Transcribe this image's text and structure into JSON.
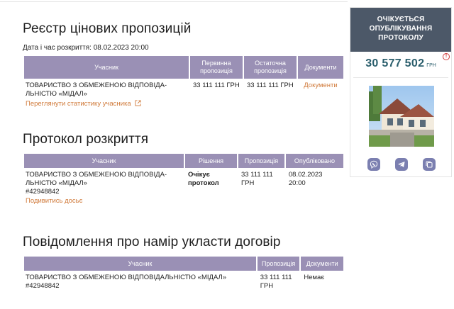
{
  "registry": {
    "title": "Реєстр цінових пропозицій",
    "open_date_label": "Дата і час розкриття: 08.02.2023 20:00",
    "headers": [
      "Учасник",
      "Первинна пропозиція",
      "Остаточна пропозиція",
      "Документи"
    ],
    "row": {
      "participant": "ТОВАРИСТВО З ОБМЕЖЕНОЮ ВІДПОВІДА-ЛЬНІСТЮ «МІДАЛ»",
      "stats_link": "Переглянути статистику учасника",
      "initial": "33 111 111 ГРН",
      "final": "33 111 111 ГРН",
      "documents": "Документи"
    }
  },
  "protocol": {
    "title": "Протокол розкриття",
    "headers": [
      "Учасник",
      "Рішення",
      "Пропозиція",
      "Опубліковано"
    ],
    "row": {
      "participant": "ТОВАРИСТВО З ОБМЕЖЕНОЮ ВІДПОВІДА-ЛЬНІСТЮ «МІДАЛ»",
      "code": "#42948842",
      "dossier_link": "Подивитись досьє",
      "decision": "Очікує протокол",
      "offer": "33 111 111 ГРН",
      "published": "08.02.2023 20:00"
    }
  },
  "notice": {
    "title": "Повідомлення про намір укласти договір",
    "headers": [
      "Учасник",
      "Пропозиція",
      "Документи"
    ],
    "row": {
      "participant": "ТОВАРИСТВО З ОБМЕЖЕНОЮ ВІДПОВІДАЛЬНІСТЮ «МІДАЛ»",
      "code": "#42948842",
      "offer": "33 111 111 ГРН",
      "documents": "Немає"
    }
  },
  "sidebar": {
    "status": "ОЧІКУЄТЬСЯ ОПУБЛІКУВАННЯ ПРОТОКОЛУ",
    "amount": "30 577 502",
    "currency": "ГРН",
    "info_icon": "!",
    "share_icons": [
      "viber-icon",
      "telegram-icon",
      "copy-icon"
    ]
  },
  "colors": {
    "table_header": "#9a90b5",
    "status_bg": "#4c5868",
    "amount": "#2a5e6c",
    "link": "#d07a3a",
    "share_button": "#7b7fb0"
  }
}
